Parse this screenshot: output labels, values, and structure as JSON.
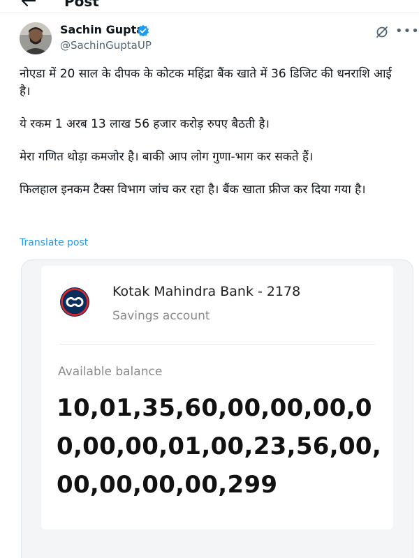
{
  "header": {
    "title": "Post"
  },
  "author": {
    "name": "Sachin Gupta",
    "handle": "@SachinGuptaUP"
  },
  "tweet": {
    "paragraphs": [
      "नोएडा में 20 साल के दीपक के कोटक महिंद्रा बैंक खाते में 36 डिजिट की धनराशि आई है।",
      "ये रकम 1 अरब 13 लाख 56 हजार करोड़ रुपए बैठती है।",
      "मेरा गणित थोड़ा कमजोर है। बाकी आप लोग गुणा-भाग कर सकते हैं।",
      "फिलहाल इनकम टैक्स विभाग जांच कर रहा है। बैंक खाता फ्रीज कर दिया गया है।"
    ],
    "translate_label": "Translate post"
  },
  "media": {
    "bank_name": "Kotak Mahindra Bank - 2178",
    "account_type": "Savings account",
    "balance_label": "Available balance",
    "balance_amount": "10,01,35,60,00,00,00,00,00,00,01,00,23,56,00,00,00,00,00,299"
  },
  "icons": {
    "back": "back-arrow-icon",
    "verified": "verified-badge-icon",
    "grok": "grok-icon",
    "more": "more-options-icon",
    "bank_logo": "kotak-logo-icon"
  },
  "colors": {
    "link": "#1d9bf0",
    "verified": "#1d9bf0",
    "text": "#0f1419",
    "secondary": "#536471",
    "kotak_red": "#e4262a",
    "kotak_navy": "#0a2e5c"
  }
}
